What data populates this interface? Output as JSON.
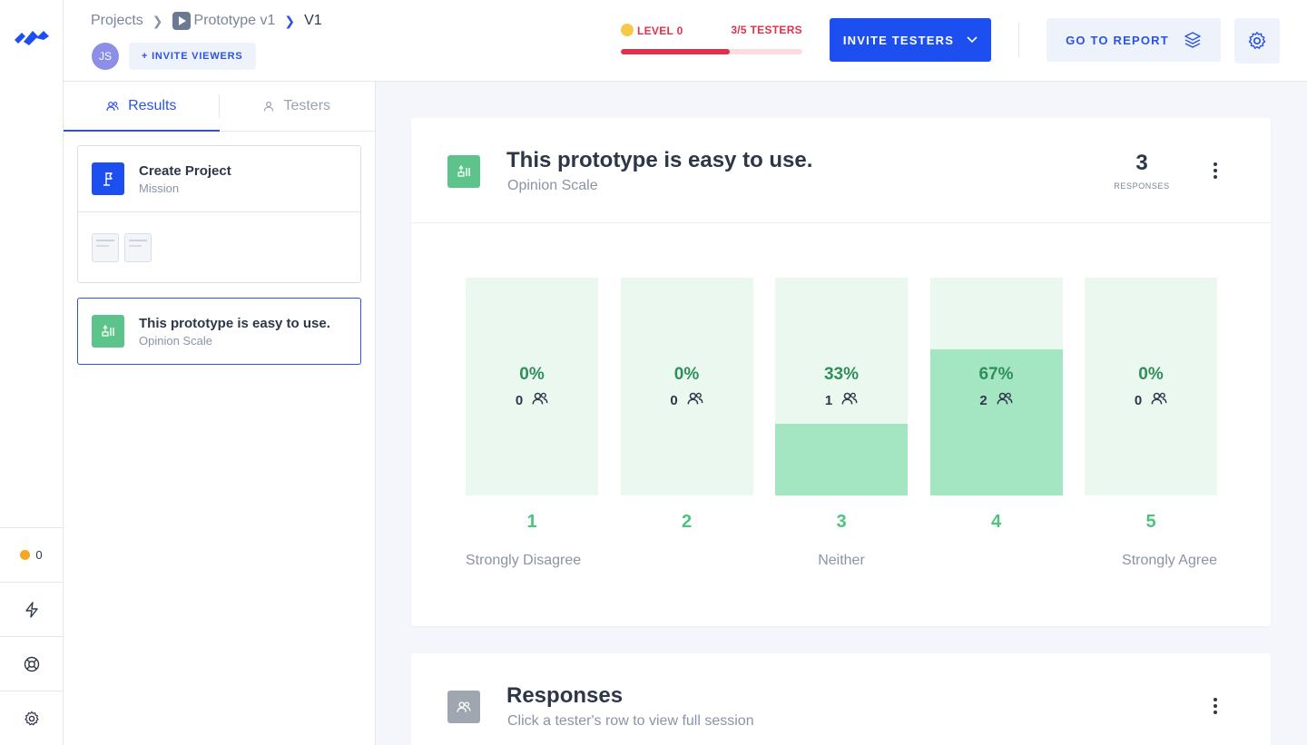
{
  "breadcrumb": {
    "projects": "Projects",
    "prototype": "Prototype v1",
    "version": "V1"
  },
  "header": {
    "avatar_initials": "JS",
    "invite_viewers": "+ INVITE VIEWERS",
    "level_label": "LEVEL 0",
    "testers_progress": "3/5 TESTERS",
    "testers_fraction": 0.6,
    "invite_testers": "INVITE TESTERS",
    "go_to_report": "GO TO REPORT"
  },
  "rail": {
    "coins": "0"
  },
  "panel": {
    "tabs": [
      {
        "label": "Results",
        "active": true
      },
      {
        "label": "Testers",
        "active": false
      }
    ],
    "blocks": [
      {
        "title": "Create Project",
        "subtitle": "Mission"
      },
      {
        "title": "This prototype is easy to use.",
        "subtitle": "Opinion Scale"
      }
    ]
  },
  "question": {
    "title": "This prototype is easy to use.",
    "subtitle": "Opinion Scale",
    "responses_count": "3",
    "responses_label": "RESPONSES"
  },
  "chart_data": {
    "type": "bar",
    "categories": [
      "1",
      "2",
      "3",
      "4",
      "5"
    ],
    "values": [
      0,
      0,
      33,
      67,
      0
    ],
    "counts": [
      0,
      0,
      1,
      2,
      0
    ],
    "percent_labels": [
      "0%",
      "0%",
      "33%",
      "67%",
      "0%"
    ],
    "scale_labels": {
      "left": "Strongly Disagree",
      "middle": "Neither",
      "right": "Strongly Agree"
    },
    "ylim": [
      0,
      100
    ]
  },
  "responses": {
    "title": "Responses",
    "subtitle": "Click a tester's row to view full session"
  },
  "colors": {
    "primary": "#1d4ff0",
    "danger": "#e0314b",
    "success": "#4cc47f",
    "bar_bg": "#eaf8f0",
    "bar_fill": "#a4e6c2"
  }
}
